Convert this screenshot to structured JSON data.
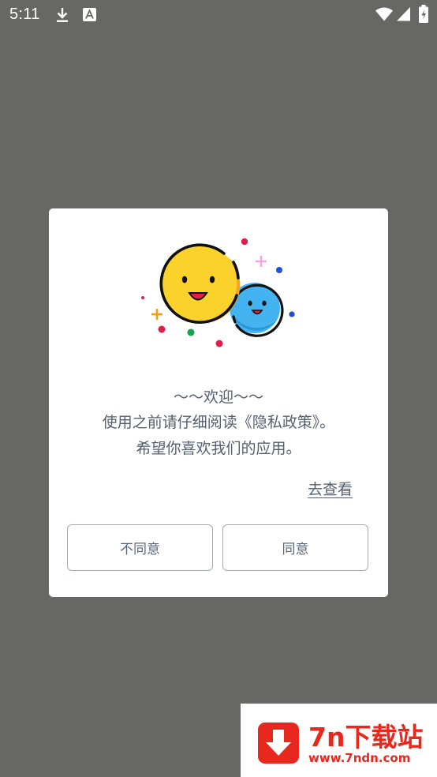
{
  "status_bar": {
    "time": "5:11",
    "icons": [
      "download-icon",
      "text-a-icon",
      "wifi-icon",
      "signal-icon",
      "battery-charging-icon"
    ]
  },
  "dialog": {
    "title": "～～欢迎～～",
    "line1": "使用之前请仔细阅读《隐私政策》。",
    "line2": "希望你喜欢我们的应用。",
    "view_link": "去查看",
    "disagree_label": "不同意",
    "agree_label": "同意",
    "illustration_icons": [
      "yellow-smiley-icon",
      "blue-smiley-icon"
    ]
  },
  "watermark": {
    "name": "7n下载站",
    "url": "www.7ndn.com",
    "icon": "download-arrow-icon"
  },
  "colors": {
    "overlay": "#676863",
    "dialog_bg": "#ffffff",
    "text": "#54606f",
    "button_border": "#a6adb8",
    "watermark_red": "#e8281e",
    "yellow_face": "#fbd12c",
    "blue_face": "#43b4f0"
  }
}
